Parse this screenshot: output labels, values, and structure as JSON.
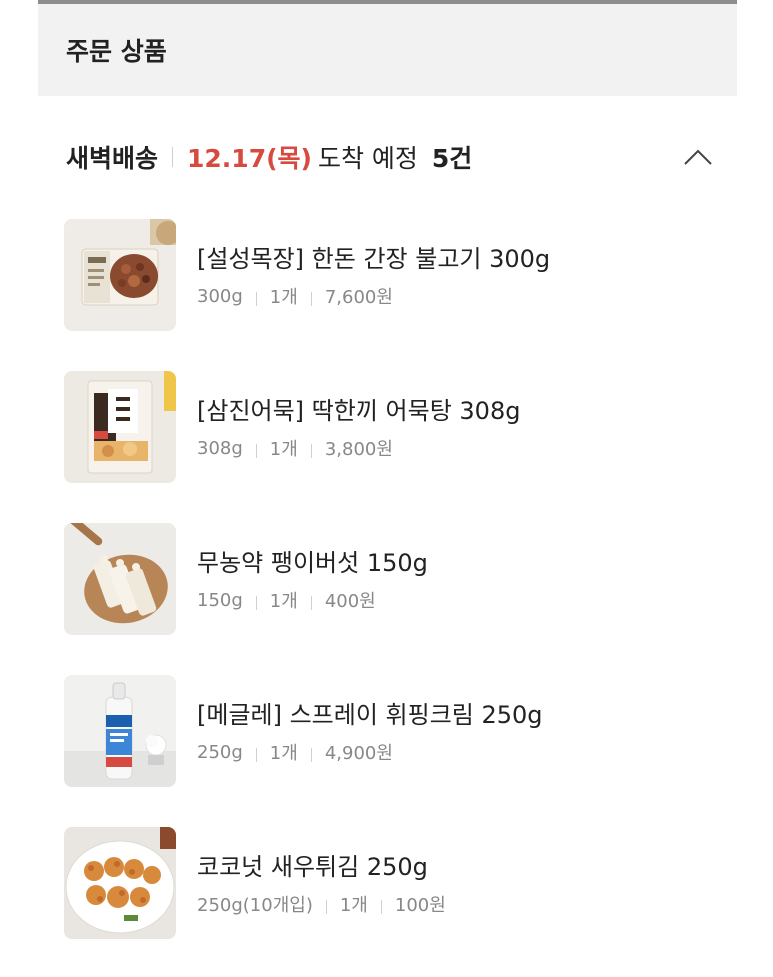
{
  "section": {
    "title": "주문 상품"
  },
  "delivery": {
    "type": "새벽배송",
    "date": "12.17(목)",
    "status": "도착 예정",
    "count": "5건",
    "date_color": "#d74a3f"
  },
  "icons": {
    "collapse": "chevron-up-icon"
  },
  "items": [
    {
      "name": "[설성목장] 한돈 간장 불고기 300g",
      "weight": "300g",
      "qty": "1개",
      "price": "7,600원"
    },
    {
      "name": "[삼진어묵] 딱한끼 어묵탕 308g",
      "weight": "308g",
      "qty": "1개",
      "price": "3,800원"
    },
    {
      "name": "무농약 팽이버섯 150g",
      "weight": "150g",
      "qty": "1개",
      "price": "400원"
    },
    {
      "name": "[메글레] 스프레이 휘핑크림 250g",
      "weight": "250g",
      "qty": "1개",
      "price": "4,900원"
    },
    {
      "name": "코코넛 새우튀김 250g",
      "weight": "250g(10개입)",
      "qty": "1개",
      "price": "100원"
    }
  ]
}
